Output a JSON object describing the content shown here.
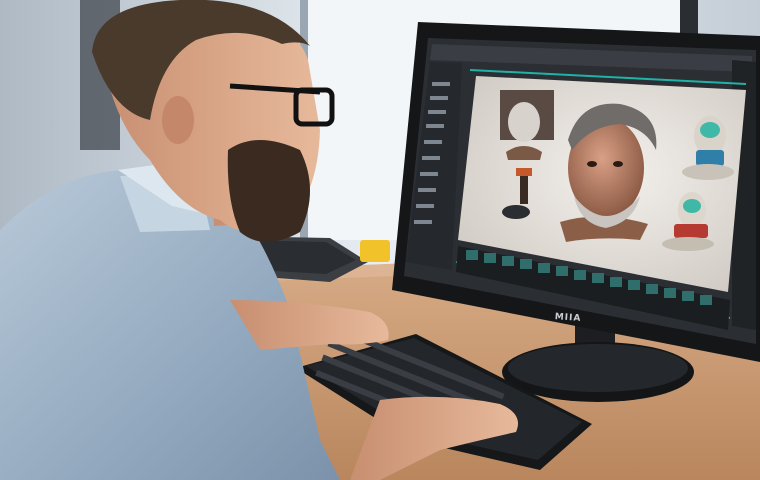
{
  "monitor": {
    "brand_label": "MIIA"
  },
  "colors": {
    "wall": "#d9e1e8",
    "window_light": "#f4f7fa",
    "desk": "#c99a72",
    "shirt": "#9fb4c8",
    "skin": "#d9a98a",
    "hair": "#4a3a2c",
    "beard": "#3a2a1f",
    "monitor_bezel": "#1a1c1f",
    "software_panel": "#2b2e33",
    "viewport": "#e8e4df",
    "accent_teal": "#1fb3a8"
  },
  "icons": [
    "person",
    "monitor",
    "keyboard",
    "3d-head-model",
    "3d-figurine",
    "second-keyboard"
  ]
}
